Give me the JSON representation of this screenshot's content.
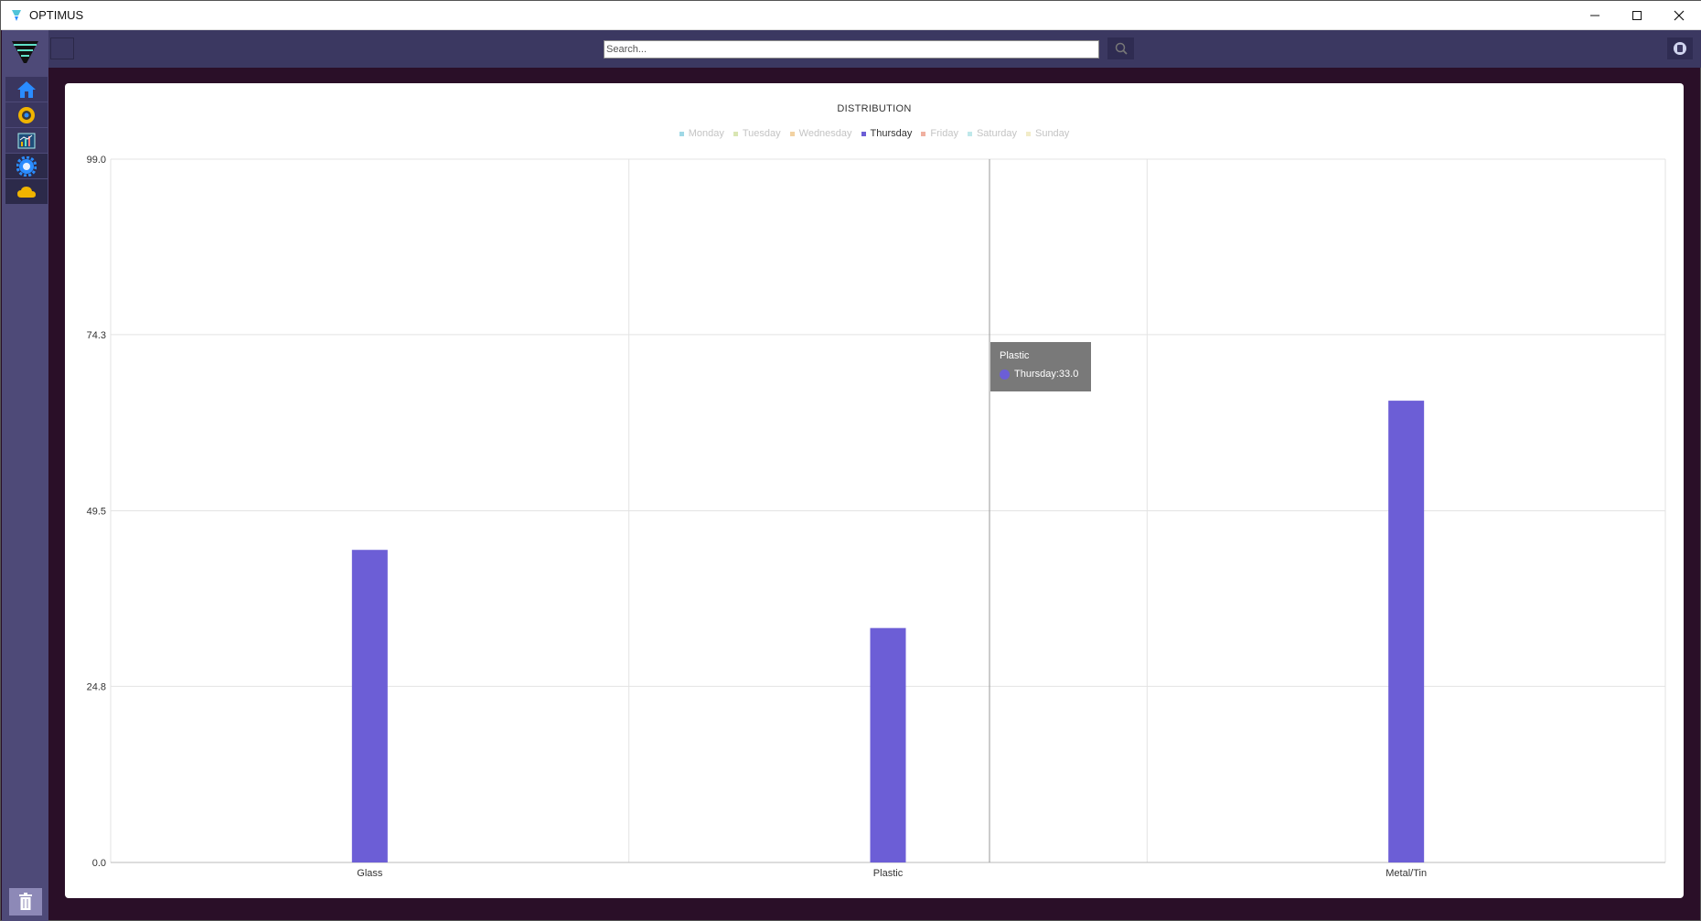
{
  "window": {
    "title": "OPTIMUS",
    "minimize_icon": "minimize-icon",
    "maximize_icon": "maximize-icon",
    "close_icon": "close-icon"
  },
  "sidebar": {
    "items": [
      {
        "name": "home",
        "icon": "home-icon",
        "color": "#2a8cff"
      },
      {
        "name": "camera",
        "icon": "camera-icon",
        "color": "#f0b400"
      },
      {
        "name": "analytics",
        "icon": "chart-icon",
        "color": "#2fa3d8"
      },
      {
        "name": "settings",
        "icon": "gear-icon",
        "color": "#2a8cff"
      },
      {
        "name": "cloud",
        "icon": "cloud-icon",
        "color": "#f0b400"
      }
    ],
    "trash_icon": "trash-icon"
  },
  "header": {
    "search_placeholder": "Search...",
    "search_icon": "search-icon",
    "user_icon": "user-icon"
  },
  "legend": [
    {
      "label": "Monday",
      "color": "#9fd8e6",
      "active": false
    },
    {
      "label": "Tuesday",
      "color": "#d9e6b3",
      "active": false
    },
    {
      "label": "Wednesday",
      "color": "#f2d2a2",
      "active": false
    },
    {
      "label": "Thursday",
      "color": "#6c5ed6",
      "active": true
    },
    {
      "label": "Friday",
      "color": "#f0b0a0",
      "active": false
    },
    {
      "label": "Saturday",
      "color": "#bfe8ea",
      "active": false
    },
    {
      "label": "Sunday",
      "color": "#f2ecc8",
      "active": false
    }
  ],
  "tooltip": {
    "title": "Plastic",
    "value_text": "Thursday:33.0"
  },
  "chart_data": {
    "type": "bar",
    "title": "DISTRIBUTION",
    "categories": [
      "Glass",
      "Plastic",
      "Metal/Tin"
    ],
    "series": [
      {
        "name": "Thursday",
        "values": [
          44.0,
          33.0,
          65.0
        ],
        "color": "#6c5ed6"
      }
    ],
    "ylim": [
      0.0,
      99.0
    ],
    "yticks": [
      "0.0",
      "24.8",
      "49.5",
      "74.3",
      "99.0"
    ],
    "grid": true,
    "legend_position": "top"
  }
}
